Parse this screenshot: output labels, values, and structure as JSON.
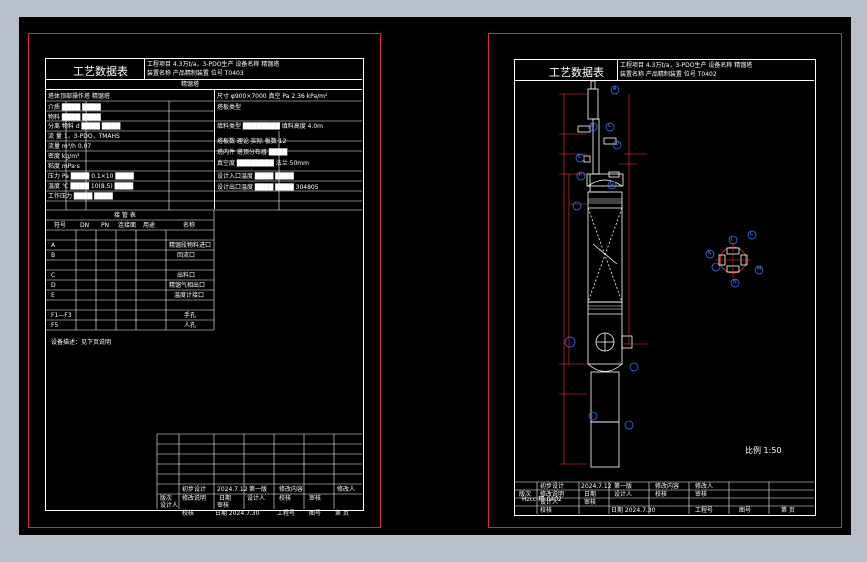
{
  "left_sheet": {
    "title": "工艺数据表",
    "project_line1": "工程项目  4.3万t/a，3-PDO生产  设备名称  精馏塔",
    "project_line2": "装置名称  产品精制装置        位号  T0403",
    "section_tower": "精馏塔",
    "header_label": "塔体顶部操作塔 精馏塔",
    "right_rows": [
      "尺寸  φ900×7000  真空 Pa  2.36 kPa/m²",
      "塔板类型  ",
      "填料类型 ████████  填料高度  4.0m",
      "塔板数  理论  实际  板数  12",
      "塔内件  塔顶分布器 ████",
      "真空度  ████████  法兰  50mm",
      "设计入口温度  ████  ████",
      "设计出口温度  ████  ████  304805"
    ],
    "left_rows": [
      "介质  ████  ████",
      "  物料  ████  ████",
      "分离  物料  d  ████  ████",
      "流  量  1，3-PDO，TMAHS",
      "流量  m³/h    0.07",
      "密度  kg/m³",
      "粘度  mPa·s",
      "压力  Pa  ████  0.1×10  ████",
      "温度  ℃  ████  10(8.5)  ████",
      "工作压力  ████  ████"
    ],
    "nozzle_title": "接 管 表",
    "nozzle_headers": [
      "符号",
      "DN",
      "PN",
      "连接面",
      "用途",
      "名称"
    ],
    "nozzle_rows": [
      {
        "mark": "A",
        "name": "精馏段物料进口"
      },
      {
        "mark": "B",
        "name": "回流口"
      },
      {
        "mark": "C",
        "name": "出料口"
      },
      {
        "mark": "D",
        "name": "精馏气相出口"
      },
      {
        "mark": "E",
        "name": "温度计接口"
      },
      {
        "mark": "F1—F3",
        "name": "手孔"
      },
      {
        "mark": "F5",
        "name": "人孔"
      }
    ],
    "note": "设备描述：见下页说明",
    "title_block": {
      "r1": [
        "初步设计",
        "2024.7.12",
        "第一版",
        "修改内容",
        "修改人"
      ],
      "r2": [
        "版次",
        "修改说明",
        "日期",
        "设计人",
        "校核",
        "审核"
      ],
      "r3": [
        "设计人",
        "审核"
      ],
      "r4": [
        "校核",
        "日期 2024.7.30",
        "工程号",
        "图号",
        "第 页"
      ]
    }
  },
  "right_sheet": {
    "title": "工艺数据表",
    "project_line1": "工程项目  4.3万t/a，3-PDO生产  设备名称  精馏塔",
    "project_line2": "装置名称  产品精制装置        位号  T0402",
    "scale": "比例 1:50",
    "drawing_no": "Hzcc-精-0402",
    "title_block": {
      "r1": [
        "初步设计",
        "2024.7.12",
        "第一版",
        "修改内容",
        "修改人"
      ],
      "r2": [
        "版次",
        "修改说明",
        "日期",
        "设计人",
        "校核",
        "审核"
      ],
      "r3": [
        "设计人",
        "审核"
      ],
      "r4": [
        "校核",
        "日期 2024.7.30",
        "工程号",
        "图号",
        "第 页"
      ]
    },
    "nozzle_marks": {
      "top": "A",
      "b": "B",
      "c": "C",
      "d": "D",
      "e": "E",
      "f": "F",
      "g": "G",
      "plan_top": "J",
      "plan_left": "K",
      "plan_right": "L",
      "plan_bottom": "M",
      "plan_low": "N"
    }
  },
  "colors": {
    "background": "#000000",
    "workspace": "#b9bfc8",
    "border_red": "#e02a2a",
    "line": "#ffffff",
    "accent_blue": "#3a6bff",
    "dim_red": "#ff3030"
  }
}
